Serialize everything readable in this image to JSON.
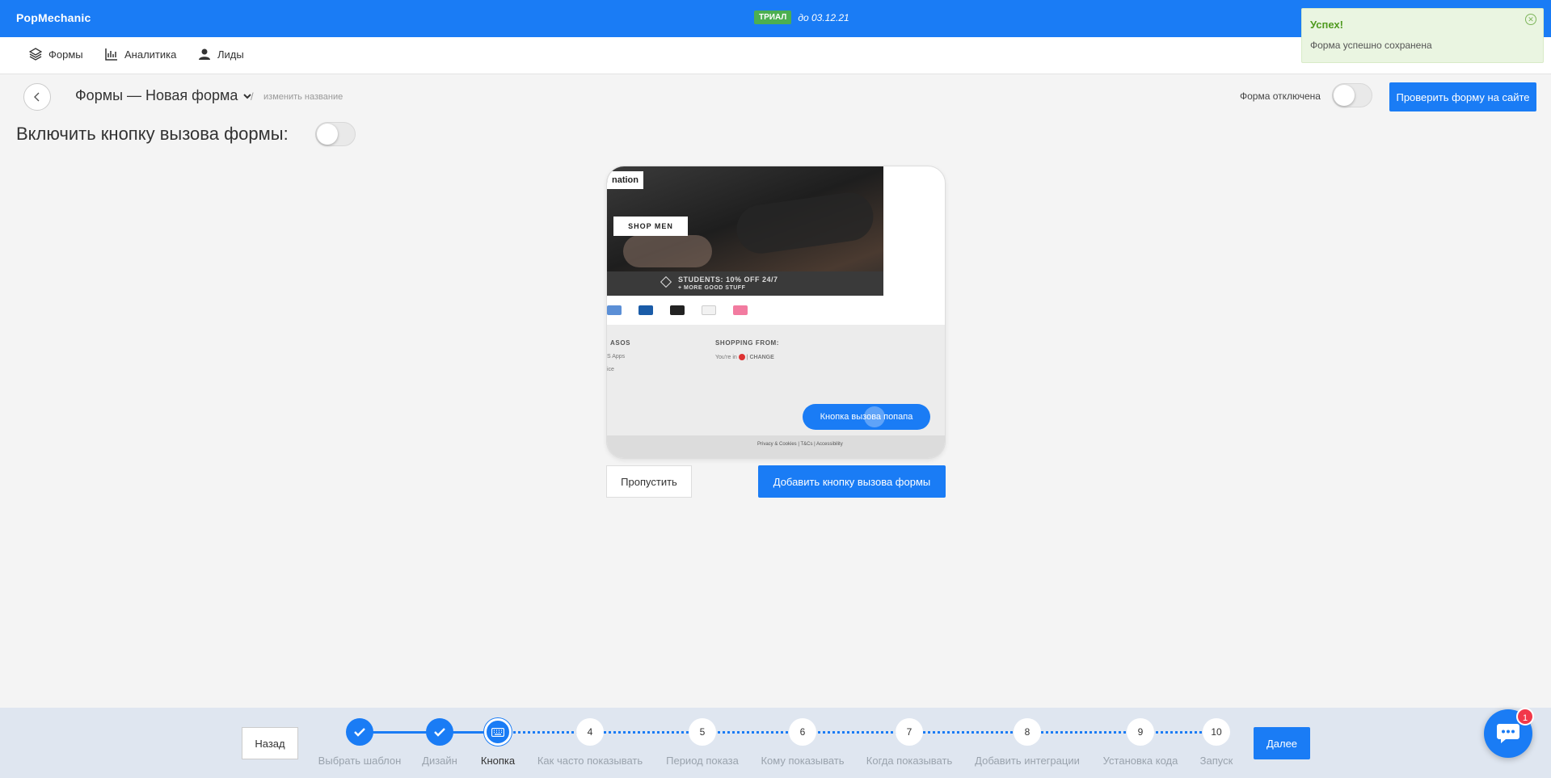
{
  "app": {
    "brand": "PopMechanic"
  },
  "trial": {
    "badge": "ТРИАЛ",
    "until": "до 03.12.21"
  },
  "nav": {
    "forms": "Формы",
    "analytics": "Аналитика",
    "leads": "Лиды"
  },
  "toast": {
    "title": "Успех!",
    "message": "Форма успешно сохранена"
  },
  "header": {
    "title": "Формы — Новая форма",
    "separator": "/",
    "rename": "изменить название",
    "status": "Форма отключена",
    "check_button": "Проверить форму на сайте"
  },
  "enable_label": "Включить кнопку вызова формы:",
  "preview": {
    "hero_tag": "nation",
    "shop_button": "SHOP MEN",
    "students_line1": "STUDENTS: 10% OFF 24/7",
    "students_line2": "+ MORE GOOD STUFF",
    "footer_head1": "ASOS",
    "footer_link1": "S Apps",
    "footer_link2": "ice",
    "footer_head2": "SHOPPING FROM:",
    "youre_in": "You're in",
    "change": "CHANGE",
    "popup_button": "Кнопка вызова попапа",
    "bottom_links": "Privacy & Cookies  |  T&Cs  |  Accessibility",
    "payment_colors": [
      "#5b8fd6",
      "#1a5ca8",
      "#222222",
      "#f2f2f2",
      "#f27ba0"
    ]
  },
  "actions": {
    "skip": "Пропустить",
    "add": "Добавить кнопку вызова формы"
  },
  "stepper": {
    "prev": "Назад",
    "next": "Далее",
    "steps": [
      {
        "label": "Выбрать шаблон",
        "state": "done",
        "number": ""
      },
      {
        "label": "Дизайн",
        "state": "done",
        "number": ""
      },
      {
        "label": "Кнопка",
        "state": "current",
        "number": ""
      },
      {
        "label": "Как часто показывать",
        "state": "todo",
        "number": "4"
      },
      {
        "label": "Период показа",
        "state": "todo",
        "number": "5"
      },
      {
        "label": "Кому показывать",
        "state": "todo",
        "number": "6"
      },
      {
        "label": "Когда показывать",
        "state": "todo",
        "number": "7"
      },
      {
        "label": "Добавить интеграции",
        "state": "todo",
        "number": "8"
      },
      {
        "label": "Установка кода",
        "state": "todo",
        "number": "9"
      },
      {
        "label": "Запуск",
        "state": "todo",
        "number": "10"
      }
    ]
  },
  "chat": {
    "badge": "1"
  },
  "colors": {
    "accent": "#1a7cf5",
    "success": "#4f9a1f",
    "badge": "#f2384a"
  }
}
